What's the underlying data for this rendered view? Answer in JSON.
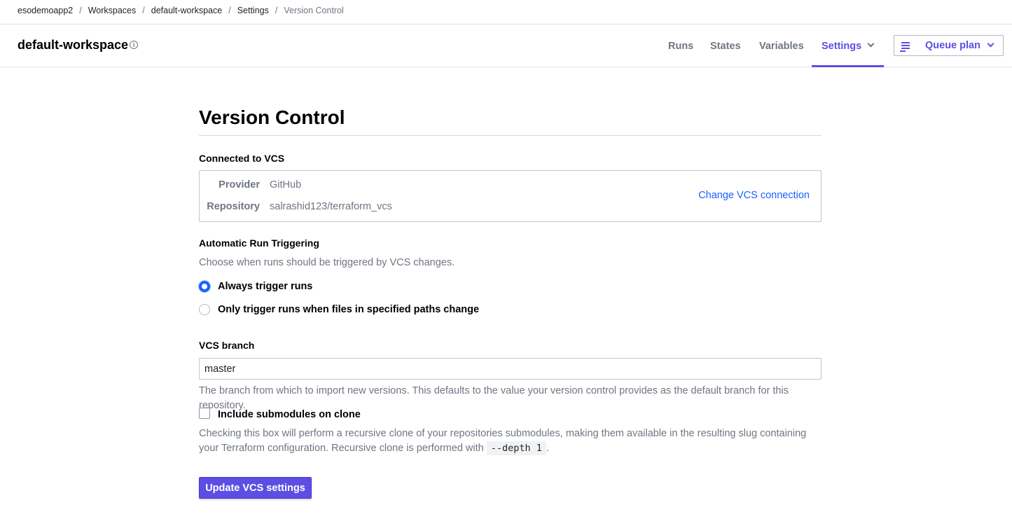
{
  "breadcrumb": [
    "esodemoapp2",
    "Workspaces",
    "default-workspace",
    "Settings",
    "Version Control"
  ],
  "header": {
    "workspace_name": "default-workspace",
    "tabs": [
      "Runs",
      "States",
      "Variables",
      "Settings"
    ],
    "active_tab": "Settings",
    "queue_button": "Queue plan"
  },
  "page": {
    "title": "Version Control",
    "vcs": {
      "heading": "Connected to VCS",
      "provider_label": "Provider",
      "provider_value": "GitHub",
      "repo_label": "Repository",
      "repo_value": "salrashid123/terraform_vcs",
      "change_link": "Change VCS connection"
    },
    "triggering": {
      "heading": "Automatic Run Triggering",
      "description": "Choose when runs should be triggered by VCS changes.",
      "options": [
        "Always trigger runs",
        "Only trigger runs when files in specified paths change"
      ],
      "selected": "Always trigger runs"
    },
    "branch": {
      "heading": "VCS branch",
      "value": "master",
      "help": "The branch from which to import new versions. This defaults to the value your version control provides as the default branch for this repository."
    },
    "submodules": {
      "label": "Include submodules on clone",
      "checked": false,
      "help_prefix": "Checking this box will perform a recursive clone of your repositories submodules, making them available in the resulting slug containing your Terraform configuration. Recursive clone is performed with ",
      "help_code": "--depth 1",
      "help_suffix": "."
    },
    "submit_button": "Update VCS settings"
  },
  "colors": {
    "accent": "#5c4ee5",
    "link": "#1563ff",
    "muted_text": "#6f7682"
  }
}
